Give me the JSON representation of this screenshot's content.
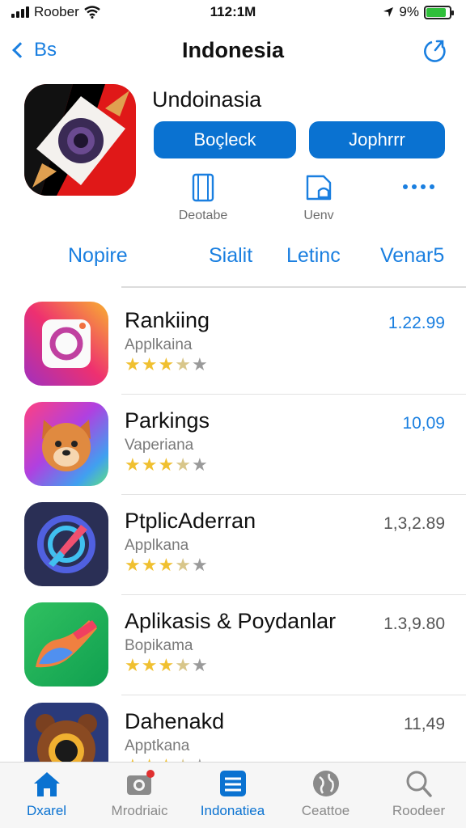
{
  "status_bar": {
    "carrier": "Roober",
    "time": "112:1M",
    "battery": "9%",
    "battery_level": 0.85
  },
  "nav": {
    "back_label": "Bs",
    "title": "Indonesia",
    "share_icon": "share-icon"
  },
  "app": {
    "name": "Undoinasia",
    "button_1": "Boçleck",
    "button_2": "Jophrrr",
    "meta": [
      {
        "label": "Deotabe",
        "icon": "phone-icon"
      },
      {
        "label": "Uenv",
        "icon": "bag-icon"
      }
    ],
    "more_icon": "ellipsis-icon"
  },
  "segments": [
    "Nopire",
    "Sialit",
    "Letinc",
    "Venar5"
  ],
  "list": [
    {
      "title": "Rankiing",
      "subtitle": "Applkaina",
      "price": "1.22.99",
      "rating": 3.5,
      "price_color": "#1a7fe0",
      "icon": "camera-app-icon"
    },
    {
      "title": "Parkings",
      "subtitle": "Vaperiana",
      "price": "10,09",
      "rating": 3.5,
      "price_color": "#1a7fe0",
      "icon": "dog-app-icon"
    },
    {
      "title": "PtplicAderran",
      "subtitle": "Applkana",
      "price": "1,3,2.89",
      "rating": 3.5,
      "price_color": "#555555",
      "icon": "compass-app-icon"
    },
    {
      "title": "Aplikasis & Poydanlar",
      "subtitle": "Bopikama",
      "price": "1.3,9.80",
      "rating": 3.5,
      "price_color": "#555555",
      "icon": "paint-app-icon"
    },
    {
      "title": "Dahenakd",
      "subtitle": "Apptkana",
      "price": "11,49",
      "rating": 3.5,
      "price_color": "#555555",
      "icon": "bear-app-icon"
    }
  ],
  "tab_bar": [
    {
      "label": "Dxarel",
      "icon": "home-icon",
      "active": true
    },
    {
      "label": "Mrodriaic",
      "icon": "camera-icon",
      "active": false
    },
    {
      "label": "Indonatiea",
      "icon": "list-icon",
      "active": true
    },
    {
      "label": "Ceattoe",
      "icon": "globe-icon",
      "active": false
    },
    {
      "label": "Roodeer",
      "icon": "search-icon",
      "active": false
    }
  ],
  "colors": {
    "accent": "#0a72d1",
    "link": "#1a7fe0",
    "star": "#f0c030",
    "star_empty": "#9a9a9a"
  }
}
